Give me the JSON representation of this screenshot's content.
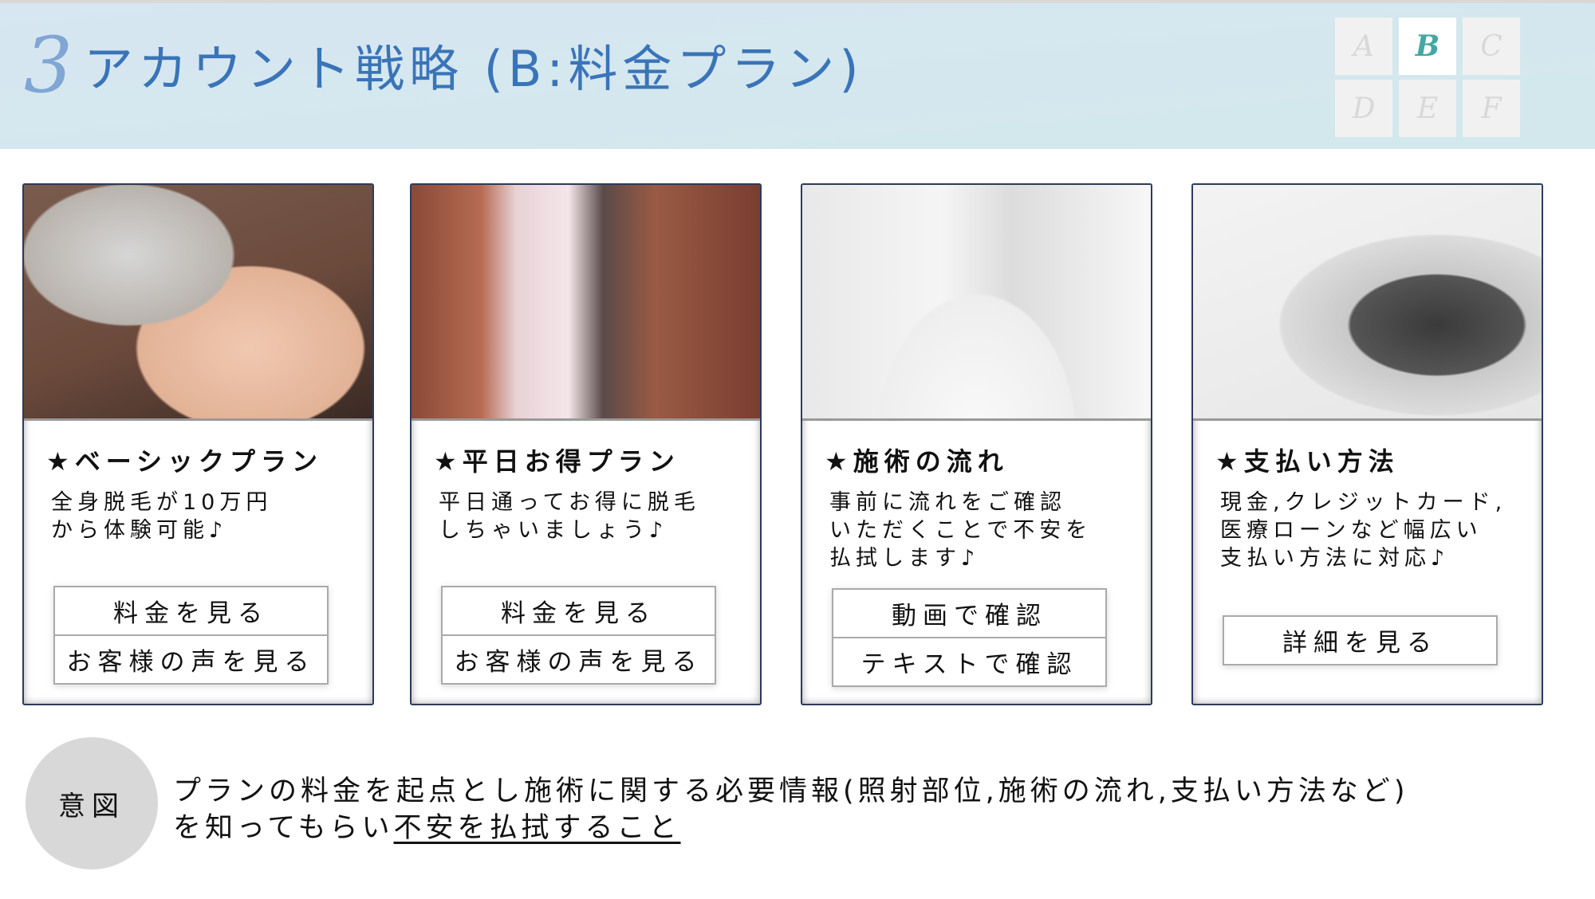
{
  "header": {
    "number": "3",
    "title": "アカウント戦略 (B:料金プラン)",
    "grid": [
      "A",
      "B",
      "C",
      "D",
      "E",
      "F"
    ],
    "active": "B",
    "accent_color": "#44a7a3"
  },
  "cards": [
    {
      "heading": "★ベーシックプラン",
      "lines": [
        "全身脱毛が10万円",
        "から体験可能♪"
      ],
      "buttons": [
        "料金を見る",
        "お客様の声を見る"
      ]
    },
    {
      "heading": "★平日お得プラン",
      "lines": [
        "平日通ってお得に脱毛",
        "しちゃいましょう♪"
      ],
      "buttons": [
        "料金を見る",
        "お客様の声を見る"
      ]
    },
    {
      "heading": "★施術の流れ",
      "lines": [
        "事前に流れをご確認",
        "いただくことで不安を",
        "払拭します♪"
      ],
      "buttons": [
        "動画で確認",
        "テキストで確認"
      ]
    },
    {
      "heading": "★支払い方法",
      "lines": [
        "現金,クレジットカード,",
        "医療ローンなど幅広い",
        "支払い方法に対応♪"
      ],
      "buttons": [
        "詳細を見る"
      ]
    }
  ],
  "intent": {
    "label": "意図",
    "line1": "プランの料金を起点とし施術に関する必要情報(照射部位,施術の流れ,支払い方法など)",
    "line2_prefix": "を知ってもらい",
    "line2_emphasis": "不安を払拭すること"
  }
}
